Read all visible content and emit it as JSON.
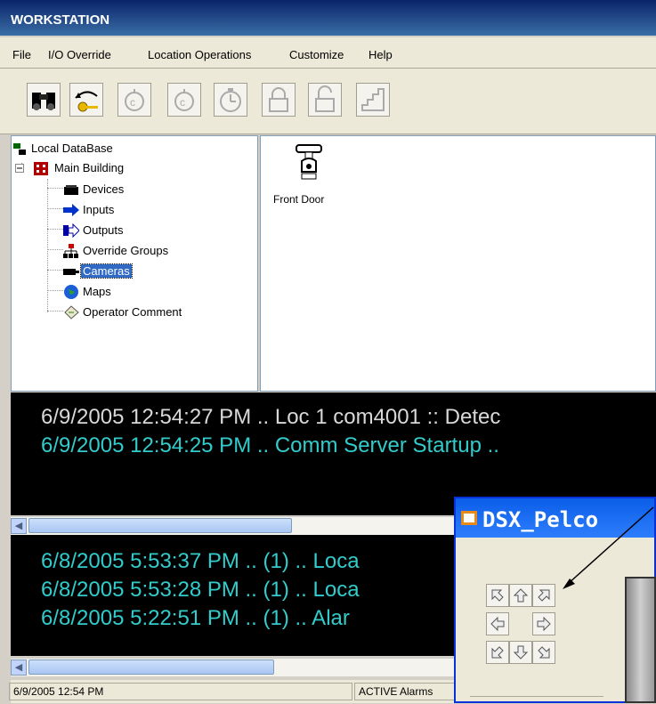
{
  "window": {
    "title": "WORKSTATION"
  },
  "menu": [
    "File",
    "I/O Override",
    "Location Operations",
    "Customize",
    "Help"
  ],
  "toolbar": [
    "binoculars-icon",
    "key-return-icon",
    "timer-a-icon",
    "timer-b-icon",
    "stopwatch-icon",
    "lock-closed-icon",
    "lock-open-icon",
    "stairs-icon"
  ],
  "tree": {
    "root": "Local DataBase",
    "building": "Main Building",
    "items": [
      "Devices",
      "Inputs",
      "Outputs",
      "Override Groups",
      "Cameras",
      "Maps",
      "Operator Comment"
    ],
    "selected": "Cameras"
  },
  "panel": {
    "camera_label": "Front Door"
  },
  "event_log": [
    {
      "text": "6/9/2005 12:54:27 PM .. Loc 1  com4001 :: Detec",
      "color": "#d8d8d8"
    },
    {
      "text": "6/9/2005 12:54:25 PM .. Comm Server Startup ..",
      "color": "#33cccc"
    }
  ],
  "alarm_log": [
    "6/8/2005 5:53:37 PM .. (1) .. Loca",
    "6/8/2005 5:53:28 PM .. (1) .. Loca",
    "6/8/2005 5:22:51 PM .. (1) .. Alar"
  ],
  "status": {
    "datetime": "6/9/2005 12:54 PM",
    "alarms": "ACTIVE Alarms"
  },
  "dialog": {
    "title": "DSX_Pelco"
  },
  "colors": {
    "title_bar": "#0a246a",
    "log_cyan": "#33cccc",
    "selection": "#316ac5"
  }
}
